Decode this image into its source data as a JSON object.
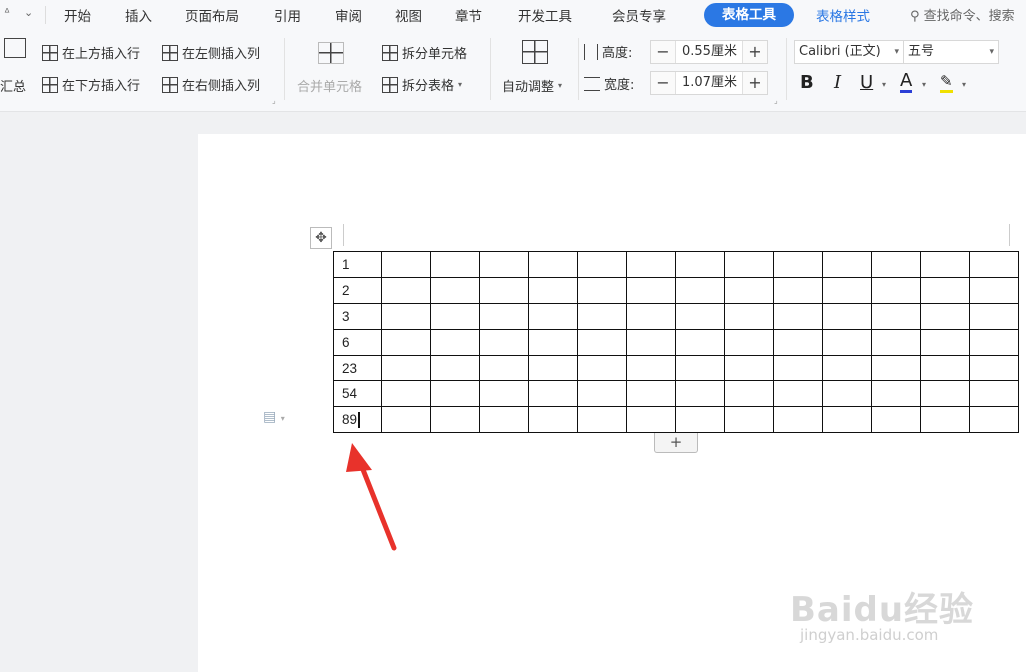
{
  "menubar": {
    "quick_sep": "ᐞ",
    "dropdown_icon": "⌄",
    "tabs": [
      "开始",
      "插入",
      "页面布局",
      "引用",
      "审阅",
      "视图",
      "章节",
      "开发工具",
      "会员专享"
    ],
    "active_tab": "表格工具",
    "style_tab": "表格样式",
    "search": "查找命令、搜索"
  },
  "ribbon": {
    "summary": "汇总",
    "insert_above": "在上方插入行",
    "insert_below": "在下方插入行",
    "insert_left": "在左侧插入列",
    "insert_right": "在右侧插入列",
    "merge_cells": "合并单元格",
    "split_cells": "拆分单元格",
    "split_table": "拆分表格",
    "auto_fit": "自动调整",
    "height_label": "高度:",
    "height_value": "0.55厘米",
    "width_label": "宽度:",
    "width_value": "1.07厘米",
    "font_name": "Calibri (正文)",
    "font_size": "五号",
    "bold": "B",
    "italic": "I",
    "underline": "U",
    "font_color": "A",
    "minus": "−",
    "plus": "+"
  },
  "table": {
    "rows": 7,
    "cols": 14,
    "first_col": [
      "1",
      "2",
      "3",
      "6",
      "23",
      "54",
      "89"
    ]
  },
  "doc": {
    "add_row": "+",
    "mover": "✥"
  },
  "watermark": {
    "brand": "Baidu经验",
    "url": "jingyan.baidu.com"
  },
  "colors": {
    "accent": "#2b78e4",
    "arrow": "#e8322b"
  }
}
